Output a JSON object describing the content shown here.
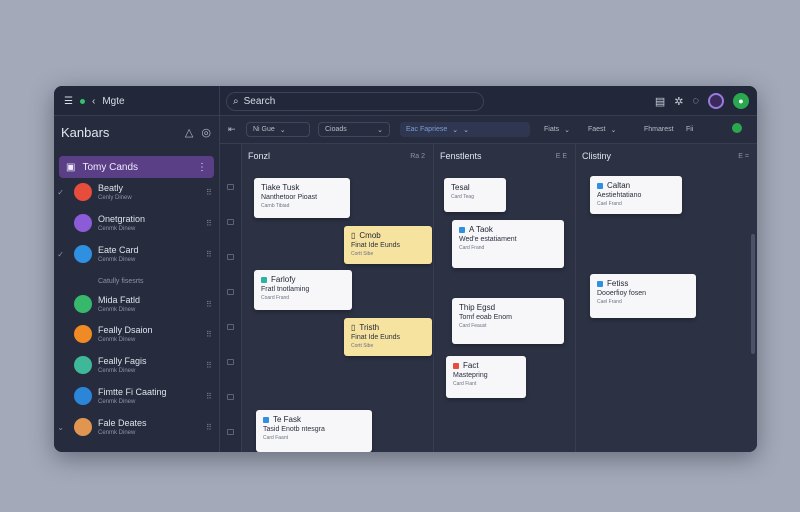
{
  "topbar": {
    "nav_label": "Mgte",
    "search_placeholder": "Search"
  },
  "sidebar": {
    "title": "Kanbars",
    "active_item": "Tomy Cands",
    "items": [
      {
        "title": "Beatly",
        "sub": "Cenly Dinew",
        "color": "#e64d3a"
      },
      {
        "title": "Onetgration",
        "sub": "Cenmk Dinew",
        "color": "#8c5cd8"
      },
      {
        "title": "Eate Card",
        "sub": "Cenmk Dinew",
        "color": "#2f8fe0"
      },
      {
        "title": "Mida Fatld",
        "sub": "Cenmk Dinew",
        "color": "#37b96b"
      },
      {
        "title": "Feally Dsaion",
        "sub": "Cenmk Dinew",
        "color": "#f08a24"
      },
      {
        "title": "Feally Fagis",
        "sub": "Cenmk Dinew",
        "color": "#3fb89a"
      },
      {
        "title": "Fimtte Fi Caating",
        "sub": "Cenmk Dinew",
        "color": "#2b86d9"
      },
      {
        "title": "Fale Deates",
        "sub": "Cenmk Dinew",
        "color": "#e09650"
      }
    ],
    "section_label": "Catully fisesrts"
  },
  "filters": {
    "f1": "Ni Gue",
    "f2": "Cioads",
    "f3": "Eac Fapriese",
    "f4": "Fiats",
    "f5": "Faest",
    "f6": "Fhmarest",
    "f7": "Fii"
  },
  "columns": [
    {
      "title": "Fonzl",
      "meta": "Ra 2"
    },
    {
      "title": "Fenstlents",
      "meta": "E E"
    },
    {
      "title": "Clistiny",
      "meta": "E ="
    }
  ],
  "cards": {
    "c1": {
      "t1": "Tiake Tusk",
      "t2": "Nanthetoor Pioast",
      "t3": "Carnb Tibiad"
    },
    "c2": {
      "t1": "Cmob",
      "t2": "Finat Ide Eunds",
      "t3": "Cortt Sibe"
    },
    "c3": {
      "t1": "Farlofy",
      "t2": "Fratl tnotlaming",
      "t3": "Coard Frand"
    },
    "c4": {
      "t1": "Tristh",
      "t2": "Finat Ide Eunds",
      "t3": "Cortt Sibe"
    },
    "c5": {
      "t1": "Te Fask",
      "t2": "Tasid Enotb ntesgra",
      "t3": "Card Faant"
    },
    "c6": {
      "t1": "Tesal",
      "t2": "Card Teag"
    },
    "c7": {
      "t1": "A Taok",
      "t2": "Wed'e estatiament",
      "t3": "Card Frand"
    },
    "c8": {
      "t1": "Thip Egsd",
      "t2": "Tomf eoab Enom",
      "t3": "Card Feaust"
    },
    "c9": {
      "t1": "Fact",
      "t2": "Mastepring",
      "t3": "Card Fiant"
    },
    "c10": {
      "t1": "Caltan",
      "t2": "Aestiehtatiano",
      "t3": "Cael Frand"
    },
    "c11": {
      "t1": "Fetiss",
      "t2": "Dooerfioy fosen",
      "t3": "Cael Frand"
    }
  }
}
